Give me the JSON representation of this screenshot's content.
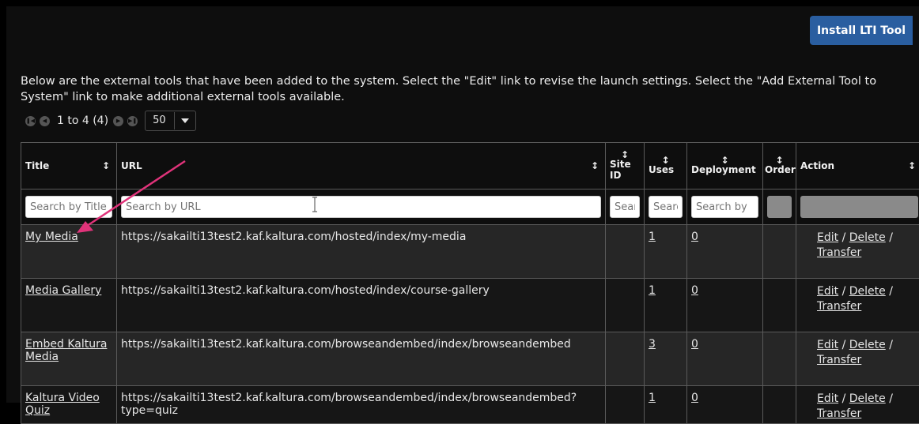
{
  "header": {
    "install_button": "Install LTI Tool"
  },
  "intro": "Below are the external tools that have been added to the system. Select the \"Edit\" link to revise the launch settings. Select the \"Add External Tool to System\" link to make additional external tools available.",
  "pager": {
    "range": "1 to 4 (4)",
    "page_size": "50"
  },
  "columns": {
    "title": "Title",
    "url": "URL",
    "site_id": "Site ID",
    "uses": "Uses",
    "deployment": "Deployment",
    "order": "Order",
    "action": "Action"
  },
  "filters": {
    "title": "Search by Title",
    "url": "Search by URL",
    "site_id": "Search",
    "uses": "Search",
    "deployment": "Search by"
  },
  "rows": [
    {
      "title": "My Media",
      "url": "https://sakailti13test2.kaf.kaltura.com/hosted/index/my-media",
      "uses": "1",
      "deployment": "0",
      "edit": "Edit",
      "delete": "Delete",
      "transfer": "Transfer"
    },
    {
      "title": "Media Gallery",
      "url": "https://sakailti13test2.kaf.kaltura.com/hosted/index/course-gallery",
      "uses": "1",
      "deployment": "0",
      "edit": "Edit",
      "delete": "Delete",
      "transfer": "Transfer"
    },
    {
      "title": "Embed Kaltura Media",
      "url": "https://sakailti13test2.kaf.kaltura.com/browseandembed/index/browseandembed",
      "uses": "3",
      "deployment": "0",
      "edit": "Edit",
      "delete": "Delete",
      "transfer": "Transfer"
    },
    {
      "title": "Kaltura Video Quiz",
      "url": "https://sakailti13test2.kaf.kaltura.com/browseandembed/index/browseandembed?type=quiz",
      "uses": "1",
      "deployment": "0",
      "edit": "Edit",
      "delete": "Delete",
      "transfer": "Transfer"
    }
  ],
  "colors": {
    "accent": "#2a5ea0",
    "annotation_arrow": "#e0337a"
  },
  "icons": [
    "first-page-icon",
    "prev-page-icon",
    "next-page-icon",
    "last-page-icon",
    "sort-icon",
    "dropdown-caret-icon",
    "text-cursor-icon",
    "annotation-arrow"
  ]
}
